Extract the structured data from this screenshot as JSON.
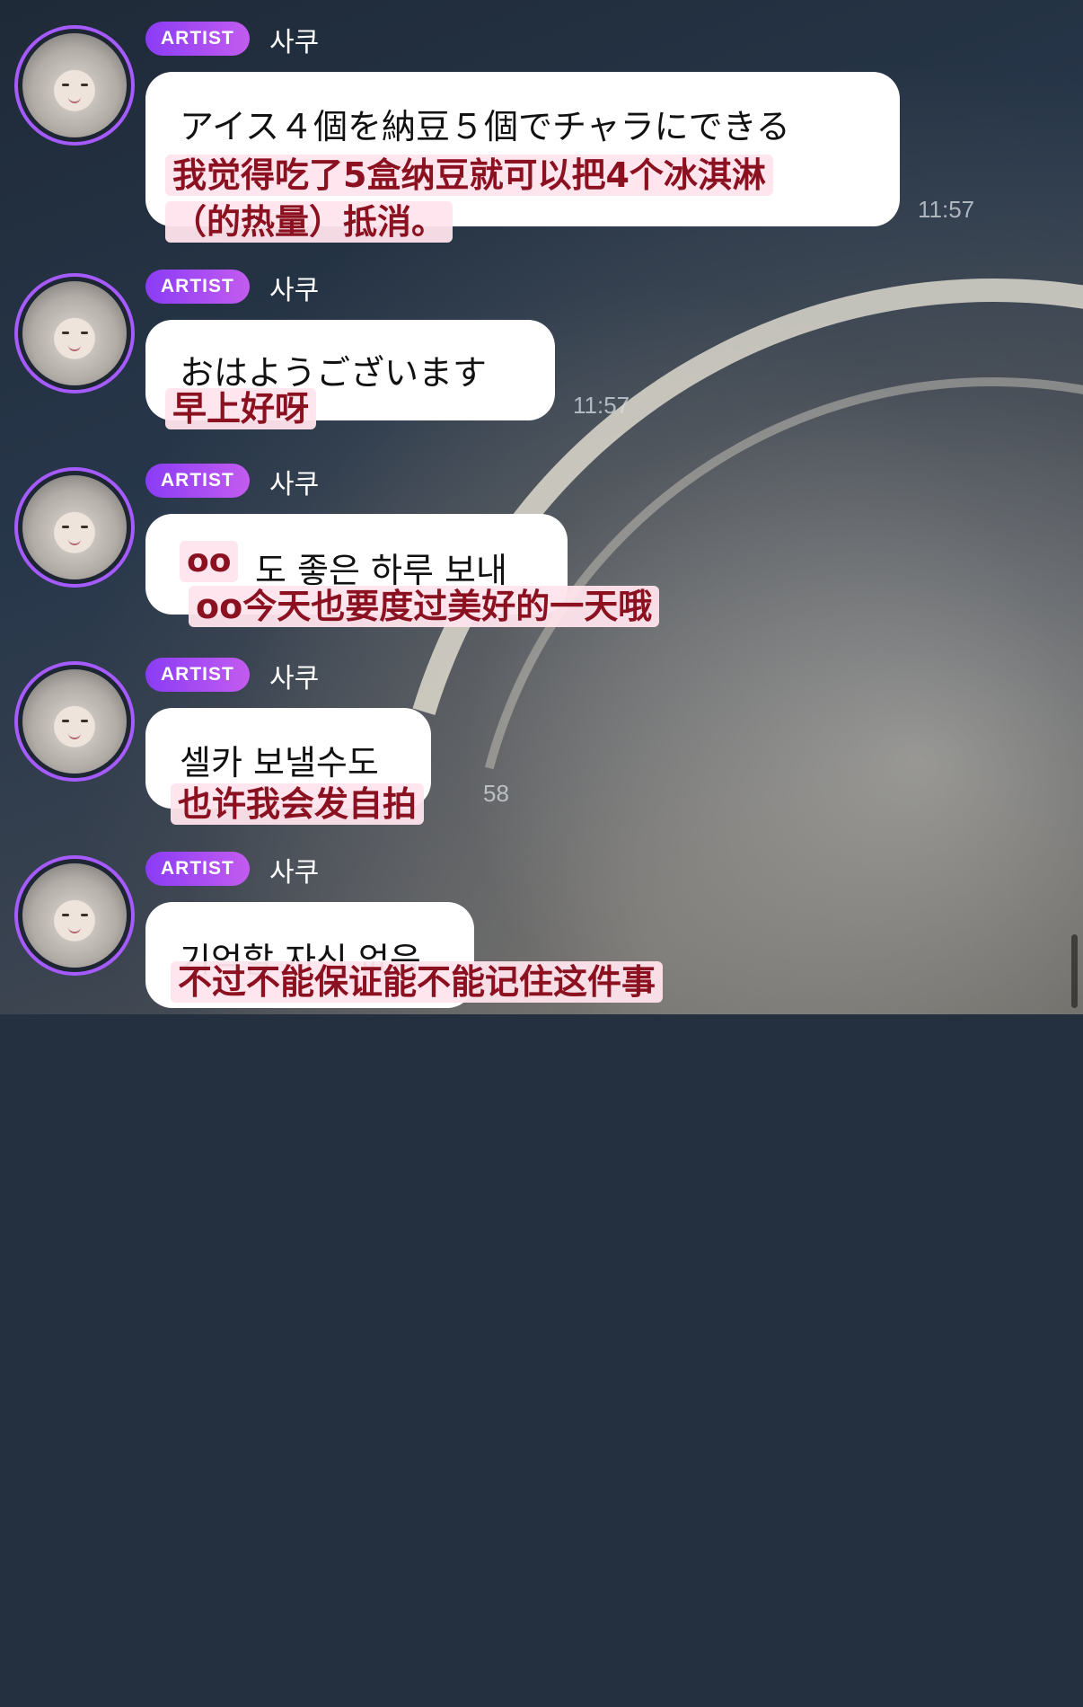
{
  "badge_label": "ARTIST",
  "messages": [
    {
      "sender": "사쿠",
      "original": "アイス４個を納豆５個でチャラにできる",
      "translation_lines": [
        "我觉得吃了5盒纳豆就可以把4个冰淇淋",
        "（的热量）抵消。"
      ],
      "time": "11:57"
    },
    {
      "sender": "사쿠",
      "original": "おはようございます",
      "translation_lines": [
        "早上好呀"
      ],
      "time": "11:57"
    },
    {
      "sender": "사쿠",
      "original_prefix": "oo",
      "original": "도 좋은 하루 보내",
      "translation_lines": [
        "oo今天也要度过美好的一天哦"
      ],
      "time": ""
    },
    {
      "sender": "사쿠",
      "original": "셀카 보낼수도",
      "translation_lines": [
        "也许我会发自拍"
      ],
      "time": "58"
    },
    {
      "sender": "사쿠",
      "original": "기억할 자신 없음",
      "translation_lines": [
        "不过不能保证能不能记住这件事"
      ],
      "time": ""
    }
  ]
}
